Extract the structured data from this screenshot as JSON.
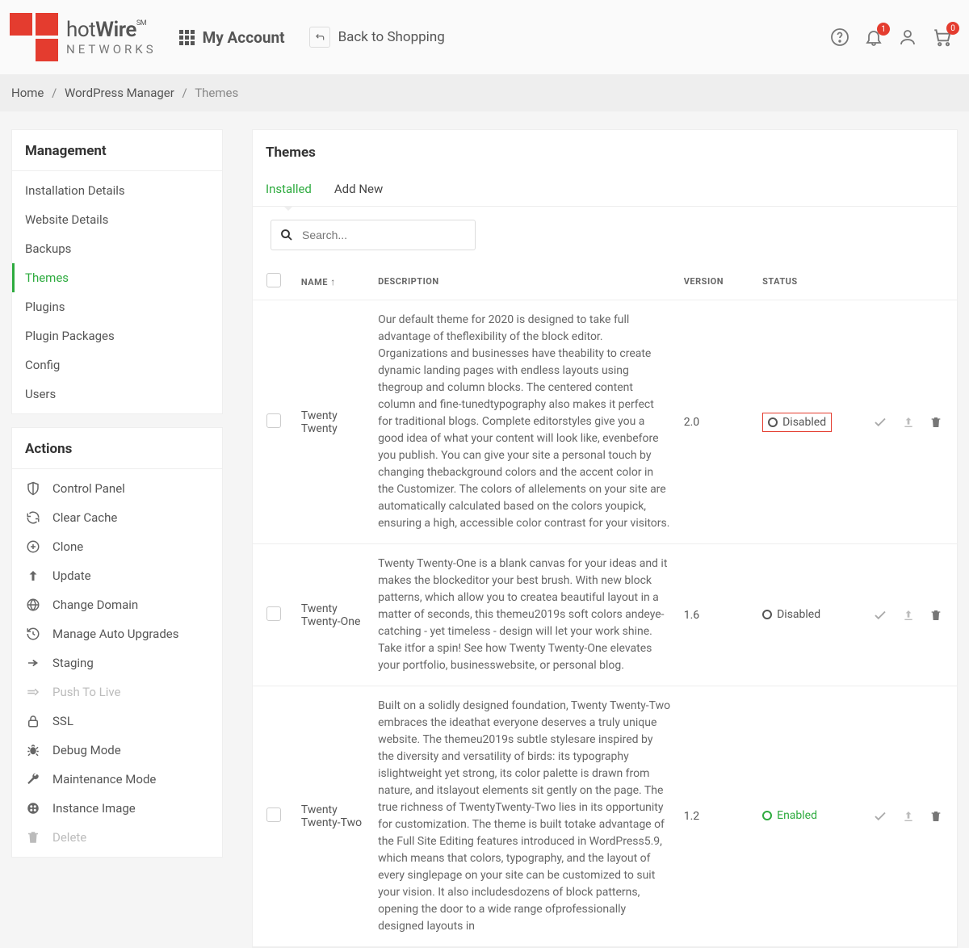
{
  "header": {
    "logo": {
      "line1_light": "hot",
      "line1_bold": "Wire",
      "sm": "SM",
      "line2": "NETWORKS"
    },
    "my_account": "My Account",
    "back_to_shopping": "Back to Shopping",
    "badges": {
      "notifications": "1",
      "cart": "0"
    }
  },
  "breadcrumb": {
    "home": "Home",
    "wp": "WordPress Manager",
    "current": "Themes",
    "sep": "/"
  },
  "sidebar": {
    "management_title": "Management",
    "management_items": [
      {
        "label": "Installation Details"
      },
      {
        "label": "Website Details"
      },
      {
        "label": "Backups"
      },
      {
        "label": "Themes"
      },
      {
        "label": "Plugins"
      },
      {
        "label": "Plugin Packages"
      },
      {
        "label": "Config"
      },
      {
        "label": "Users"
      }
    ],
    "actions_title": "Actions",
    "actions_items": [
      {
        "label": "Control Panel",
        "icon": "shield-icon"
      },
      {
        "label": "Clear Cache",
        "icon": "refresh-icon"
      },
      {
        "label": "Clone",
        "icon": "clone-icon"
      },
      {
        "label": "Update",
        "icon": "arrow-up-icon"
      },
      {
        "label": "Change Domain",
        "icon": "globe-icon"
      },
      {
        "label": "Manage Auto Upgrades",
        "icon": "history-icon"
      },
      {
        "label": "Staging",
        "icon": "arrow-right-icon"
      },
      {
        "label": "Push To Live",
        "icon": "push-icon",
        "disabled": true
      },
      {
        "label": "SSL",
        "icon": "lock-icon"
      },
      {
        "label": "Debug Mode",
        "icon": "bug-icon"
      },
      {
        "label": "Maintenance Mode",
        "icon": "wrench-icon"
      },
      {
        "label": "Instance Image",
        "icon": "image-icon"
      },
      {
        "label": "Delete",
        "icon": "trash-icon",
        "disabled": true
      }
    ]
  },
  "main": {
    "title": "Themes",
    "tabs": {
      "installed": "Installed",
      "addnew": "Add New"
    },
    "search_placeholder": "Search...",
    "columns": {
      "name": "NAME",
      "desc": "DESCRIPTION",
      "version": "VERSION",
      "status": "STATUS",
      "sort": "↑"
    },
    "rows": [
      {
        "name": "Twenty Twenty",
        "desc": "Our default theme for 2020 is designed to take full advantage of theflexibility of the block editor. Organizations and businesses have theability to create dynamic landing pages with endless layouts using thegroup and column blocks. The centered content column and fine-tunedtypography also makes it perfect for traditional blogs. Complete editorstyles give you a good idea of what your content will look like, evenbefore you publish. You can give your site a personal touch by changing thebackground colors and the accent color in the Customizer. The colors of allelements on your site are automatically calculated based on the colors youpick, ensuring a high, accessible color contrast for your visitors.",
        "version": "2.0",
        "status": "Disabled",
        "enabled": false,
        "highlight": true
      },
      {
        "name": "Twenty Twenty-One",
        "desc": "Twenty Twenty-One is a blank canvas for your ideas and it makes the blockeditor your best brush. With new block patterns, which allow you to createa beautiful layout in a matter of seconds, this themeu2019s soft colors andeye-catching - yet timeless - design will let your work shine. Take itfor a spin! See how Twenty Twenty-One elevates your portfolio, businesswebsite, or personal blog.",
        "version": "1.6",
        "status": "Disabled",
        "enabled": false,
        "highlight": false
      },
      {
        "name": "Twenty Twenty-Two",
        "desc": "Built on a solidly designed foundation, Twenty Twenty-Two embraces the ideathat everyone deserves a truly unique website. The themeu2019s subtle stylesare inspired by the diversity and versatility of birds: its typography islightweight yet strong, its color palette is drawn from nature, and itslayout elements sit gently on the page. The true richness of TwentyTwenty-Two lies in its opportunity for customization. The theme is built totake advantage of the Full Site Editing features introduced in WordPress5.9, which means that colors, typography, and the layout of every singlepage on your site can be customized to suit your vision. It also includesdozens of block patterns, opening the door to a wide range ofprofessionally designed layouts in",
        "version": "1.2",
        "status": "Enabled",
        "enabled": true,
        "highlight": false
      }
    ]
  }
}
